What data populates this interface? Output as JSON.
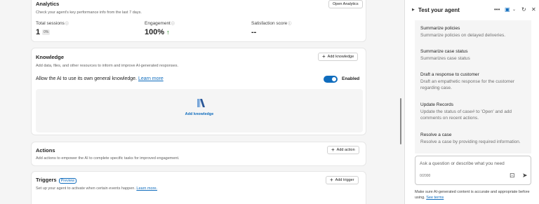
{
  "analytics": {
    "title": "Analytics",
    "description": "Check your agent's key performance info from the last 7 days.",
    "open_button": "Open Analytics",
    "metrics": [
      {
        "label": "Total sessions",
        "value": "1",
        "badge": "0%"
      },
      {
        "label": "Engagement",
        "value": "100%",
        "trend": "↑"
      },
      {
        "label": "Satisfaction score",
        "value": "--"
      }
    ]
  },
  "knowledge": {
    "title": "Knowledge",
    "description": "Add data, files, and other resources to inform and improve AI-generated responses.",
    "add_button": "Add knowledge",
    "general_text": "Allow the AI to use its own general knowledge.",
    "learn_more": "Learn more",
    "toggle_label": "Enabled",
    "toggle_on": true,
    "drop_label": "Add knowledge"
  },
  "actions": {
    "title": "Actions",
    "description": "Add actions to empower the AI to complete specific tasks for improved engagement.",
    "add_button": "Add action"
  },
  "triggers": {
    "title": "Triggers",
    "badge": "Preview",
    "description": "Set up your agent to activate when certain events happen.",
    "learn_more": "Learn more.",
    "add_button": "Add trigger"
  },
  "test_panel": {
    "title": "Test your agent",
    "items": [
      {
        "title": "Summarize policies",
        "desc": "Summarize policies on delayed deliveries."
      },
      {
        "title": "Summarize case status",
        "desc": "Summarizes case status"
      },
      {
        "title": "Draft a response to customer",
        "desc": "Draft an empathetic response for the customer regarding case."
      },
      {
        "title": "Update Records",
        "desc": "Update the status of case# to 'Open' and add comments on recent actions."
      },
      {
        "title": "Resolve a case",
        "desc": "Resolve a case by providing required information."
      }
    ],
    "input_placeholder": "Ask a question or describe what you need",
    "char_count": "0/2000",
    "disclaimer": "Make sure AI-generated content is accurate and appropriate before using.",
    "see_terms": "See terms"
  },
  "colors": {
    "accent": "#0f6cbd",
    "positive": "#107c10"
  }
}
